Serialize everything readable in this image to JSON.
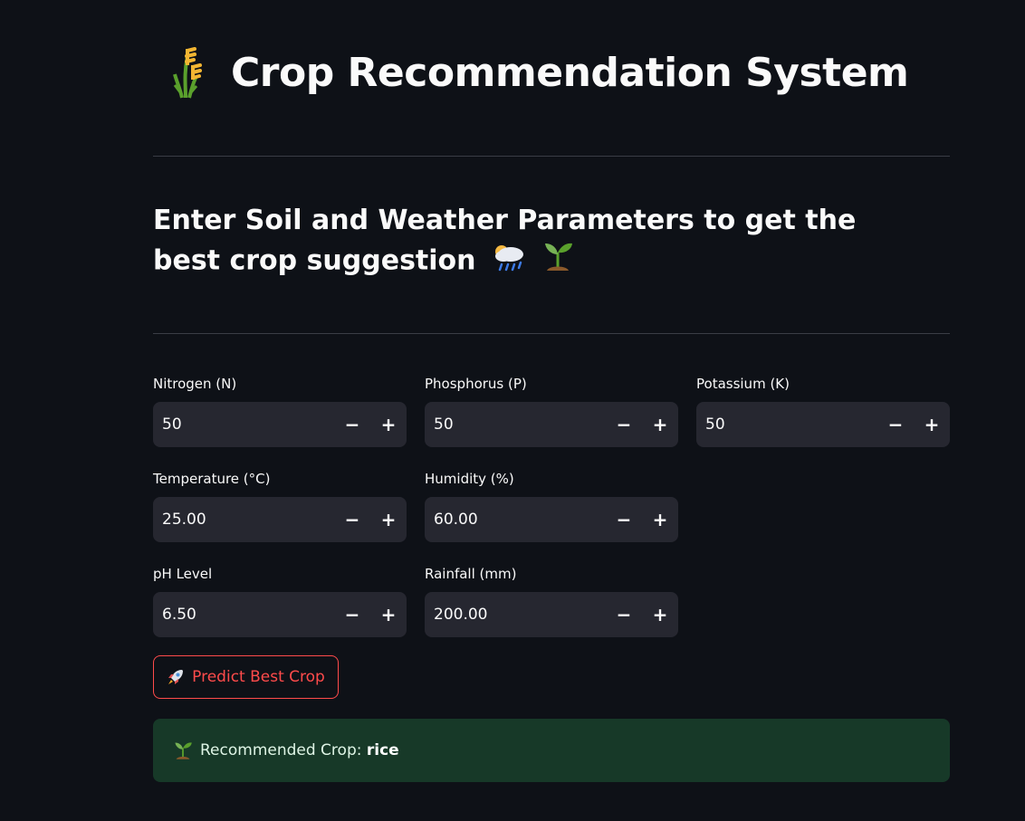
{
  "app": {
    "title": "Crop Recommendation System",
    "title_icon": "sheaf-of-rice-icon",
    "subtitle": "Enter Soil and Weather Parameters to get the best crop suggestion",
    "subtitle_icons": [
      "cloud-with-rain-icon",
      "seedling-icon"
    ]
  },
  "fields": {
    "nitrogen": {
      "label": "Nitrogen (N)",
      "value": "50"
    },
    "phosphorus": {
      "label": "Phosphorus (P)",
      "value": "50"
    },
    "potassium": {
      "label": "Potassium (K)",
      "value": "50"
    },
    "temperature": {
      "label": "Temperature (°C)",
      "value": "25.00"
    },
    "humidity": {
      "label": "Humidity (%)",
      "value": "60.00"
    },
    "ph": {
      "label": "pH Level",
      "value": "6.50"
    },
    "rainfall": {
      "label": "Rainfall (mm)",
      "value": "200.00"
    }
  },
  "stepper": {
    "minus": "−",
    "plus": "+"
  },
  "predict_button": {
    "label": "Predict Best Crop",
    "icon": "rocket-icon"
  },
  "result": {
    "prefix": "Recommended Crop: ",
    "crop": "rice",
    "icon": "seedling-icon"
  },
  "colors": {
    "background": "#0e1117",
    "input_bg": "#262730",
    "accent": "#ff4b4b",
    "success_bg": "#173928"
  }
}
